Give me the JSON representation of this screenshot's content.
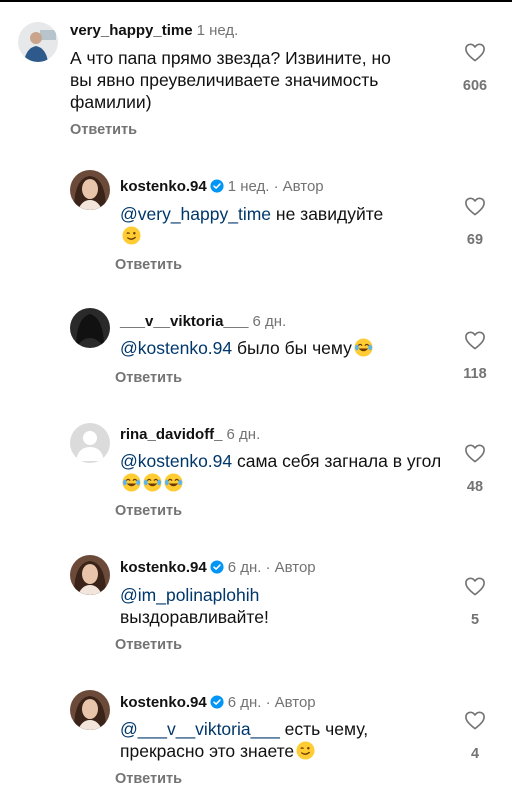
{
  "colors": {
    "text": "#111111",
    "muted": "#737373",
    "mention": "#00376b",
    "verified": "#0095f6"
  },
  "comments": [
    {
      "username": "very_happy_time",
      "time": "1 нед.",
      "author_badge": "",
      "text": "А что папа прямо звезда? Извините, но вы явно преувеличиваете значимость фамилии)",
      "reply_label": "Ответить",
      "likes": "606"
    },
    {
      "username": "kostenko.94",
      "time": "1 нед. ·",
      "author_badge": "Автор",
      "mention": "@very_happy_time",
      "text": " не завидуйте",
      "emojis": [
        "winking-face"
      ],
      "reply_label": "Ответить",
      "likes": "69"
    },
    {
      "username": "___v__viktoria___",
      "time": "6 дн.",
      "author_badge": "",
      "mention": "@kostenko.94",
      "text": " было бы чему",
      "emojis": [
        "tears-of-joy"
      ],
      "reply_label": "Ответить",
      "likes": "118"
    },
    {
      "username": "rina_davidoff_",
      "time": "6 дн.",
      "author_badge": "",
      "mention": "@kostenko.94",
      "text": " сама себя загнала в угол",
      "emojis": [
        "tears-of-joy",
        "tears-of-joy",
        "tears-of-joy"
      ],
      "reply_label": "Ответить",
      "likes": "48"
    },
    {
      "username": "kostenko.94",
      "time": "6 дн. ·",
      "author_badge": "Автор",
      "mention": "@im_polinaplohih",
      "text": " выздоравливайте!",
      "reply_label": "Ответить",
      "likes": "5"
    },
    {
      "username": "kostenko.94",
      "time": "6 дн. ·",
      "author_badge": "Автор",
      "mention": "@___v__viktoria___",
      "text": " есть чему, прекрасно это знаете",
      "emojis": [
        "winking-face"
      ],
      "reply_label": "Ответить",
      "likes": "4"
    }
  ]
}
